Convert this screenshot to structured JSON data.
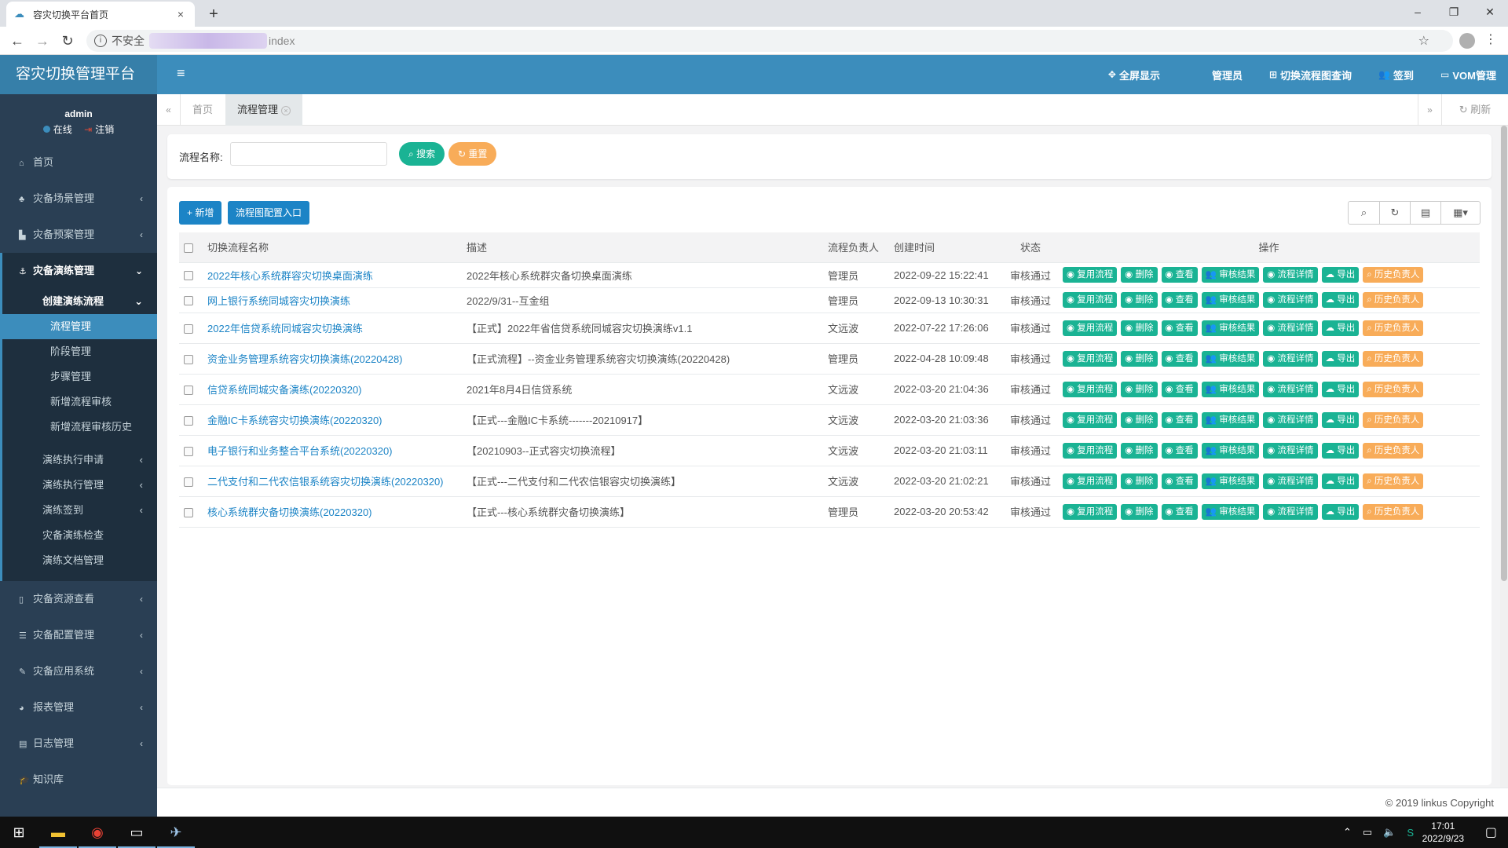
{
  "browser": {
    "tab_title": "容灾切换平台首页",
    "tab_close": "×",
    "new_tab": "+",
    "security_label": "不安全",
    "url_visible": "index",
    "win_min": "–",
    "win_max": "❐",
    "win_close": "✕"
  },
  "header": {
    "app_title": "容灾切换管理平台",
    "nav": [
      {
        "label": "全屏显示",
        "icon": "expand-icon"
      },
      {
        "label": "管理员",
        "icon": ""
      },
      {
        "label": "切换流程图查询",
        "icon": "sitemap-icon"
      },
      {
        "label": "签到",
        "icon": "users-icon"
      },
      {
        "label": "VOM管理",
        "icon": "monitor-icon"
      }
    ]
  },
  "user": {
    "name": "admin",
    "status": "在线",
    "logout": "注销"
  },
  "sidebar": {
    "items": [
      {
        "label": "首页"
      },
      {
        "label": "灾备场景管理"
      },
      {
        "label": "灾备预案管理"
      },
      {
        "label": "灾备演练管理"
      }
    ],
    "sub_head": "创建演练流程",
    "sub_items": [
      "流程管理",
      "阶段管理",
      "步骤管理",
      "新增流程审核",
      "新增流程审核历史"
    ],
    "sub_items2": [
      "演练执行申请",
      "演练执行管理",
      "演练签到",
      "灾备演练检查",
      "演练文档管理"
    ],
    "items_bottom": [
      {
        "label": "灾备资源查看"
      },
      {
        "label": "灾备配置管理"
      },
      {
        "label": "灾备应用系统"
      },
      {
        "label": "报表管理"
      },
      {
        "label": "日志管理"
      },
      {
        "label": "知识库"
      }
    ]
  },
  "content_tabs": {
    "home": "首页",
    "active": "流程管理",
    "refresh": "刷新"
  },
  "search": {
    "label": "流程名称:",
    "value": "",
    "search_btn": "搜索",
    "reset_btn": "重置"
  },
  "toolbar": {
    "add": "新增",
    "config_entry": "流程图配置入口"
  },
  "table": {
    "headers": [
      "切换流程名称",
      "描述",
      "流程负责人",
      "创建时间",
      "状态",
      "操作"
    ],
    "actions": [
      "复用流程",
      "删除",
      "查看",
      "审核结果",
      "流程详情",
      "导出",
      "历史负责人"
    ],
    "rows": [
      {
        "name": "2022年核心系统群容灾切换桌面演练",
        "desc": "2022年核心系统群灾备切换桌面演练",
        "owner": "管理员",
        "created": "2022-09-22 15:22:41",
        "status": "审核通过"
      },
      {
        "name": "网上银行系统同城容灾切换演练",
        "desc": "2022/9/31--互金组",
        "owner": "管理员",
        "created": "2022-09-13 10:30:31",
        "status": "审核通过"
      },
      {
        "name": "2022年信贷系统同城容灾切换演练",
        "desc": "【正式】2022年省信贷系统同城容灾切换演练v1.1",
        "owner": "文远波",
        "created": "2022-07-22 17:26:06",
        "status": "审核通过"
      },
      {
        "name": "资金业务管理系统容灾切换演练(20220428)",
        "desc": "【正式流程】--资金业务管理系统容灾切换演练(20220428)",
        "owner": "管理员",
        "created": "2022-04-28 10:09:48",
        "status": "审核通过"
      },
      {
        "name": "信贷系统同城灾备演练(20220320)",
        "desc": "2021年8月4日信贷系统",
        "owner": "文远波",
        "created": "2022-03-20 21:04:36",
        "status": "审核通过"
      },
      {
        "name": "金融IC卡系统容灾切换演练(20220320)",
        "desc": "【正式---金融IC卡系统-------20210917】",
        "owner": "文远波",
        "created": "2022-03-20 21:03:36",
        "status": "审核通过"
      },
      {
        "name": "电子银行和业务整合平台系统(20220320)",
        "desc": "【20210903--正式容灾切换流程】",
        "owner": "文远波",
        "created": "2022-03-20 21:03:11",
        "status": "审核通过"
      },
      {
        "name": "二代支付和二代农信银系统容灾切换演练(20220320)",
        "desc": "【正式---二代支付和二代农信银容灾切换演练】",
        "owner": "文远波",
        "created": "2022-03-20 21:02:21",
        "status": "审核通过"
      },
      {
        "name": "核心系统群灾备切换演练(20220320)",
        "desc": "【正式---核心系统群灾备切换演练】",
        "owner": "管理员",
        "created": "2022-03-20 20:53:42",
        "status": "审核通过"
      }
    ]
  },
  "footer": {
    "copyright": "© 2019 linkus Copyright"
  },
  "taskbar": {
    "time": "17:01",
    "date": "2022/9/23"
  }
}
